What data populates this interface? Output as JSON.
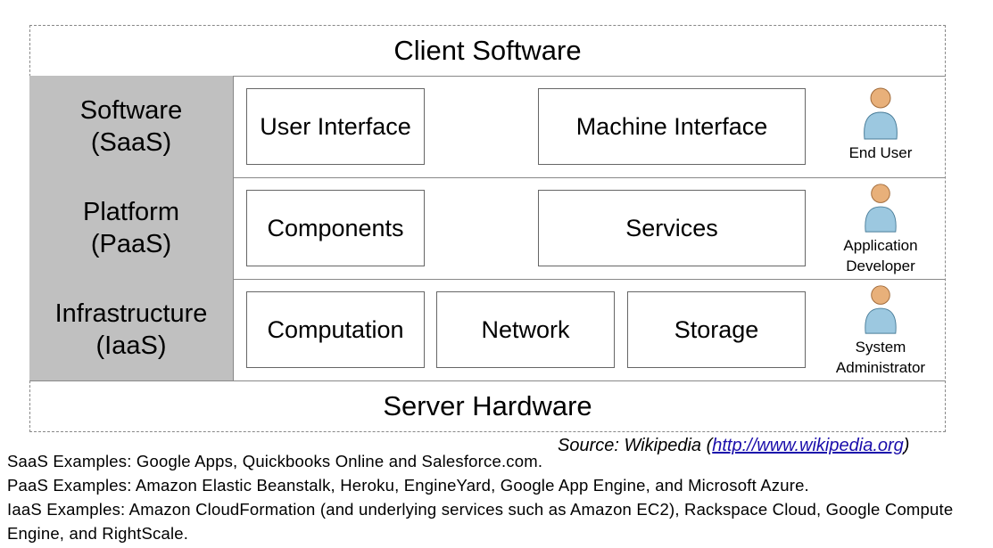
{
  "diagram": {
    "top_band": "Client Software",
    "bottom_band": "Server Hardware",
    "layers": [
      {
        "name": "Software",
        "abbr": "(SaaS)",
        "components": [
          "User Interface",
          "Machine Interface"
        ],
        "actor": [
          "End User"
        ]
      },
      {
        "name": "Platform",
        "abbr": "(PaaS)",
        "components": [
          "Components",
          "Services"
        ],
        "actor": [
          "Application",
          "Developer"
        ]
      },
      {
        "name": "Infrastructure",
        "abbr": "(IaaS)",
        "components": [
          "Computation",
          "Network",
          "Storage"
        ],
        "actor": [
          "System",
          "Administrator"
        ]
      }
    ],
    "colors": {
      "layer_label_bg": "#c0c0c0",
      "person_body": "#9cc8e0",
      "person_head": "#e8b07a"
    }
  },
  "source": {
    "prefix": "Source: Wikipedia (",
    "link": "http://www.wikipedia.org",
    "suffix": ")"
  },
  "examples": [
    "SaaS Examples: Google Apps, Quickbooks Online and Salesforce.com.",
    "PaaS Examples: Amazon Elastic Beanstalk, Heroku, EngineYard, Google App Engine, and Microsoft Azure.",
    "IaaS Examples: Amazon CloudFormation (and underlying services such as Amazon EC2), Rackspace Cloud, Google Compute",
    "Engine, and RightScale."
  ]
}
